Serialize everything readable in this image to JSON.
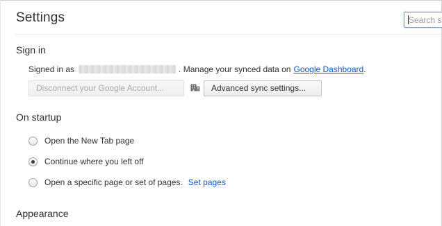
{
  "header": {
    "title": "Settings",
    "search_placeholder": "Search settings"
  },
  "sign_in": {
    "heading": "Sign in",
    "signed_in_prefix": "Signed in as",
    "manage_text": ". Manage your synced data on",
    "dashboard_link": "Google Dashboard",
    "period": ".",
    "disconnect_button": "Disconnect your Google Account...",
    "advanced_sync_button": "Advanced sync settings..."
  },
  "on_startup": {
    "heading": "On startup",
    "options": [
      {
        "label": "Open the New Tab page",
        "checked": false
      },
      {
        "label": "Continue where you left off",
        "checked": true
      },
      {
        "label": "Open a specific page or set of pages.",
        "checked": false
      }
    ],
    "set_pages_link": "Set pages"
  },
  "appearance": {
    "heading": "Appearance"
  },
  "icons": {
    "managed": "building-icon"
  },
  "colors": {
    "link": "#1155cc",
    "search_focus": "#6d9fd8"
  }
}
